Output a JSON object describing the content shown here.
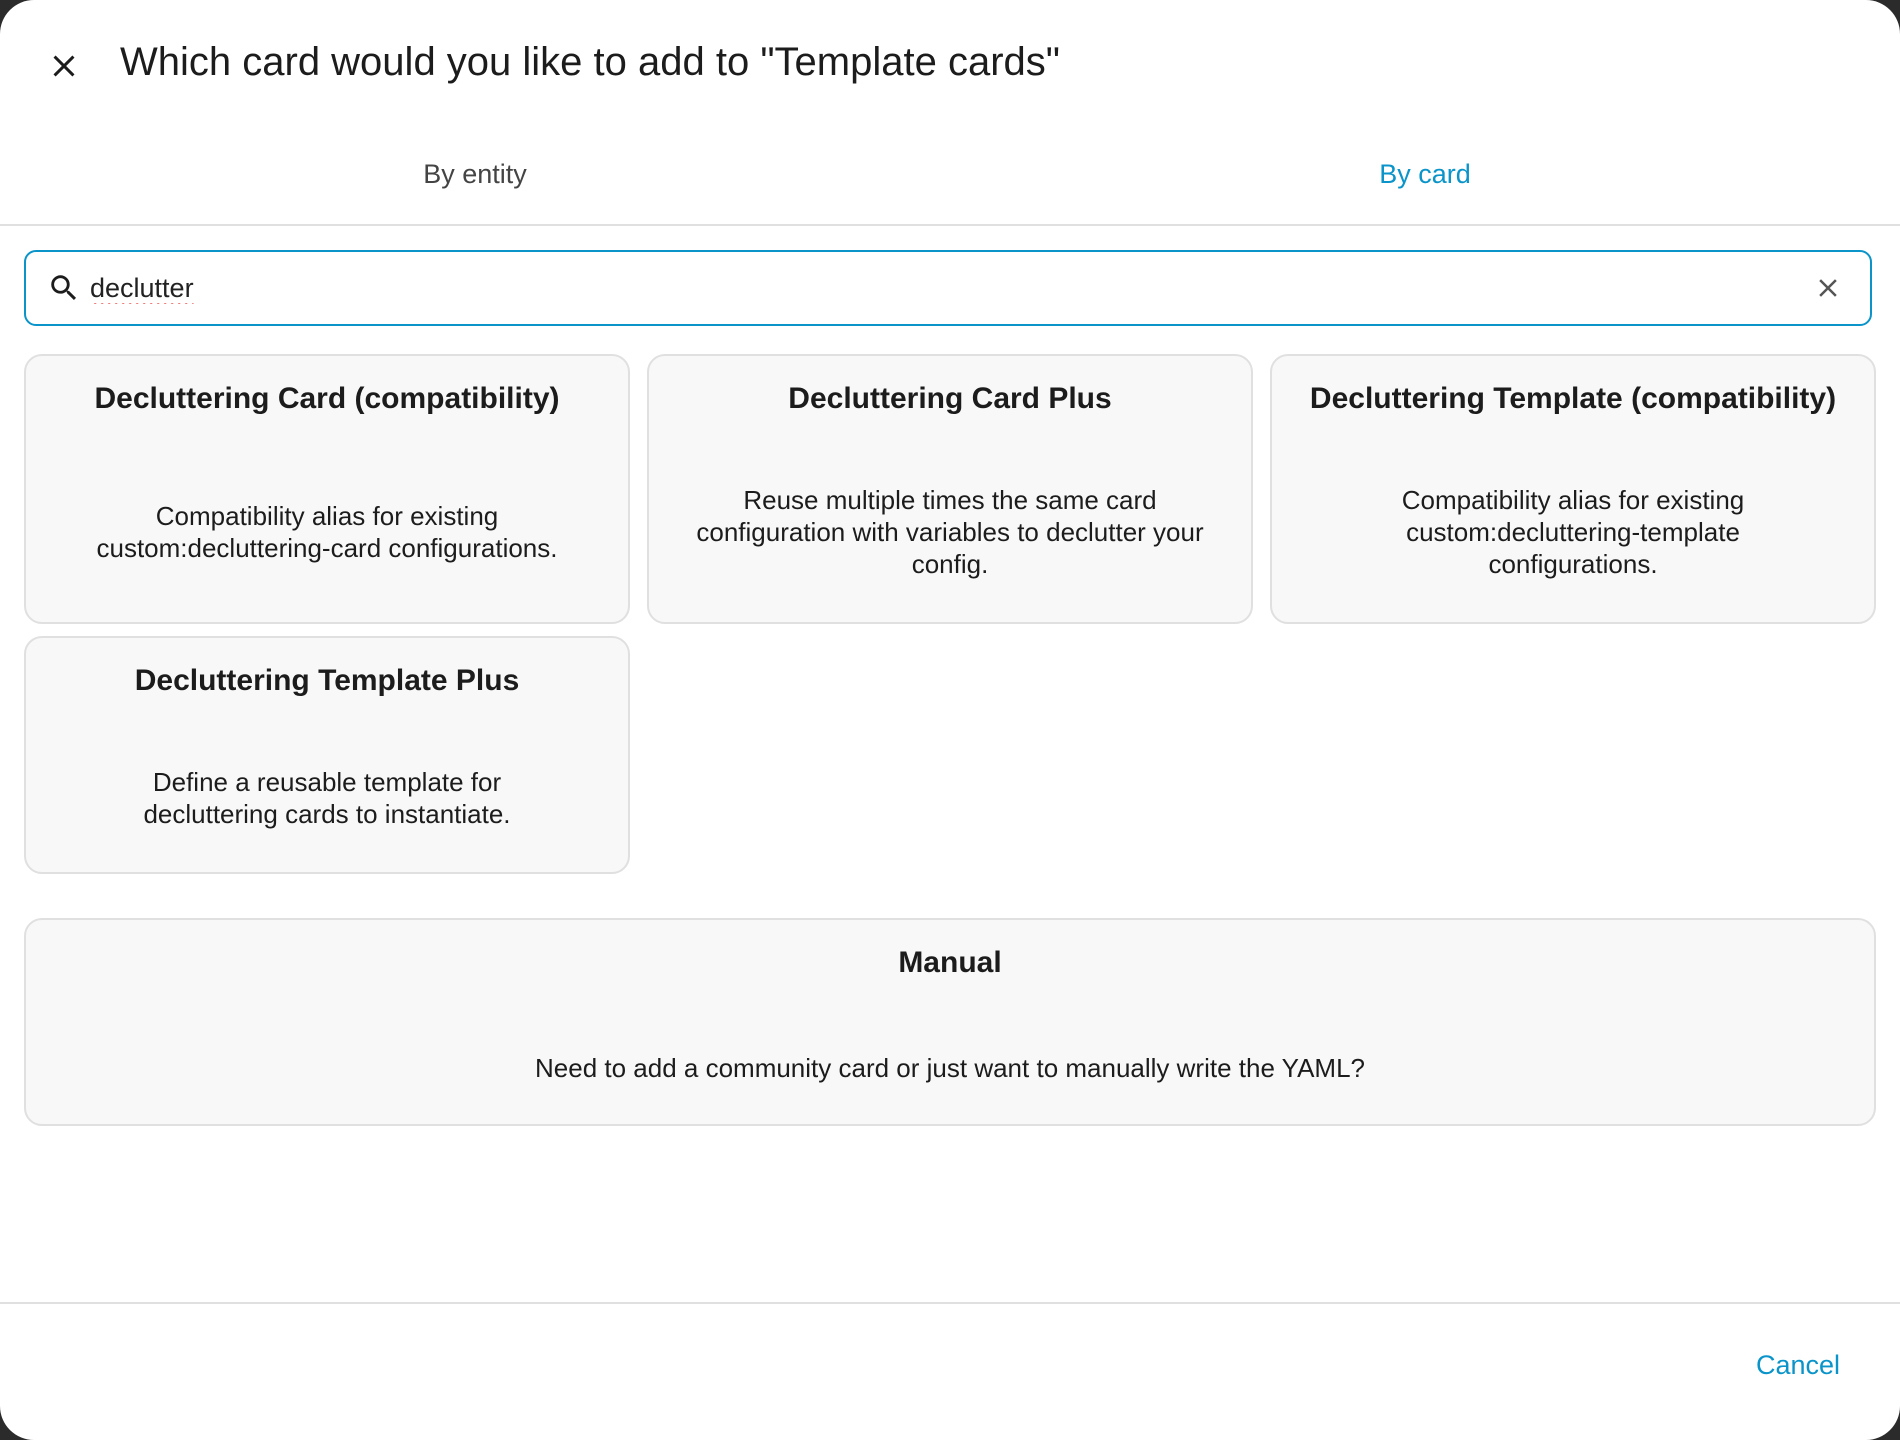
{
  "dialog": {
    "title": "Which card would you like to add to \"Template cards\""
  },
  "tabs": [
    {
      "label": "By entity",
      "active": false
    },
    {
      "label": "By card",
      "active": true
    }
  ],
  "search": {
    "value": "declutter"
  },
  "cards": [
    {
      "title": "Decluttering Card (compatibility)",
      "description": "Compatibility alias for existing custom:decluttering-card configurations."
    },
    {
      "title": "Decluttering Card Plus",
      "description": "Reuse multiple times the same card configuration with variables to declutter your config."
    },
    {
      "title": "Decluttering Template (compatibility)",
      "description": "Compatibility alias for existing custom:decluttering-template configurations."
    },
    {
      "title": "Decluttering Template Plus",
      "description": "Define a reusable template for decluttering cards to instantiate."
    }
  ],
  "manual": {
    "title": "Manual",
    "description": "Need to add a community card or just want to manually write the YAML?"
  },
  "footer": {
    "cancel_label": "Cancel"
  },
  "colors": {
    "accent": "#0a94c9",
    "card_bg": "#f8f8f8",
    "border": "#e0e0e0"
  }
}
